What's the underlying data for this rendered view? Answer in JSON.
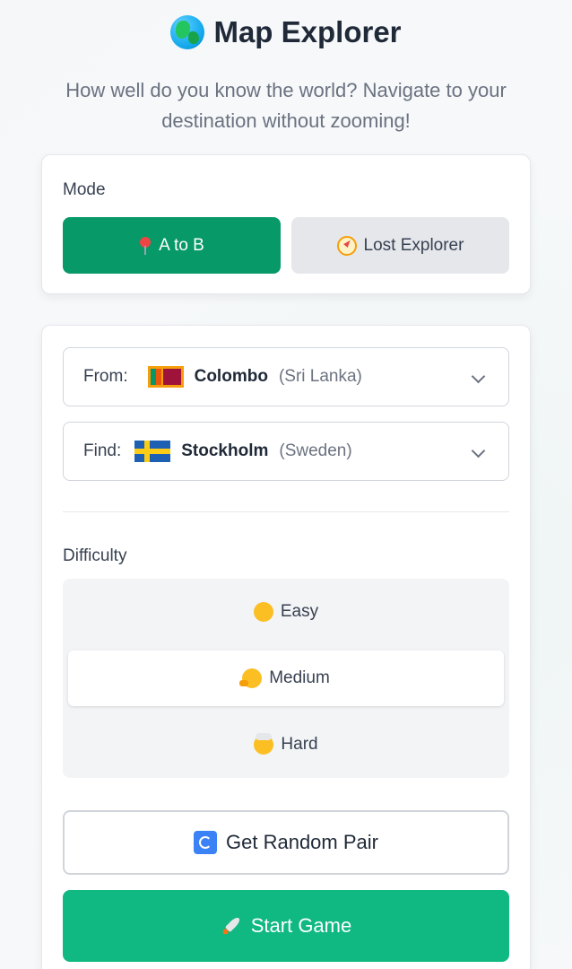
{
  "header": {
    "title": "Map Explorer",
    "subtitle": "How well do you know the world? Navigate to your destination without zooming!",
    "icon": "globe-icon"
  },
  "mode": {
    "label": "Mode",
    "options": [
      {
        "label": "A to B",
        "icon": "pin-icon",
        "active": true
      },
      {
        "label": "Lost Explorer",
        "icon": "compass-icon",
        "active": false
      }
    ]
  },
  "route": {
    "from": {
      "label": "From:",
      "city": "Colombo",
      "country": "(Sri Lanka)",
      "flag": "sri-lanka-flag-icon"
    },
    "find": {
      "label": "Find:",
      "city": "Stockholm",
      "country": "(Sweden)",
      "flag": "sweden-flag-icon"
    }
  },
  "difficulty": {
    "label": "Difficulty",
    "options": [
      {
        "label": "Easy",
        "icon": "smile-emoji-icon",
        "selected": false
      },
      {
        "label": "Medium",
        "icon": "thinking-emoji-icon",
        "selected": true
      },
      {
        "label": "Hard",
        "icon": "exploding-head-emoji-icon",
        "selected": false
      }
    ]
  },
  "actions": {
    "random_label": "Get Random Pair",
    "start_label": "Start Game"
  },
  "colors": {
    "primary": "#079968",
    "start": "#10b981",
    "inactive": "#e5e7eb"
  }
}
